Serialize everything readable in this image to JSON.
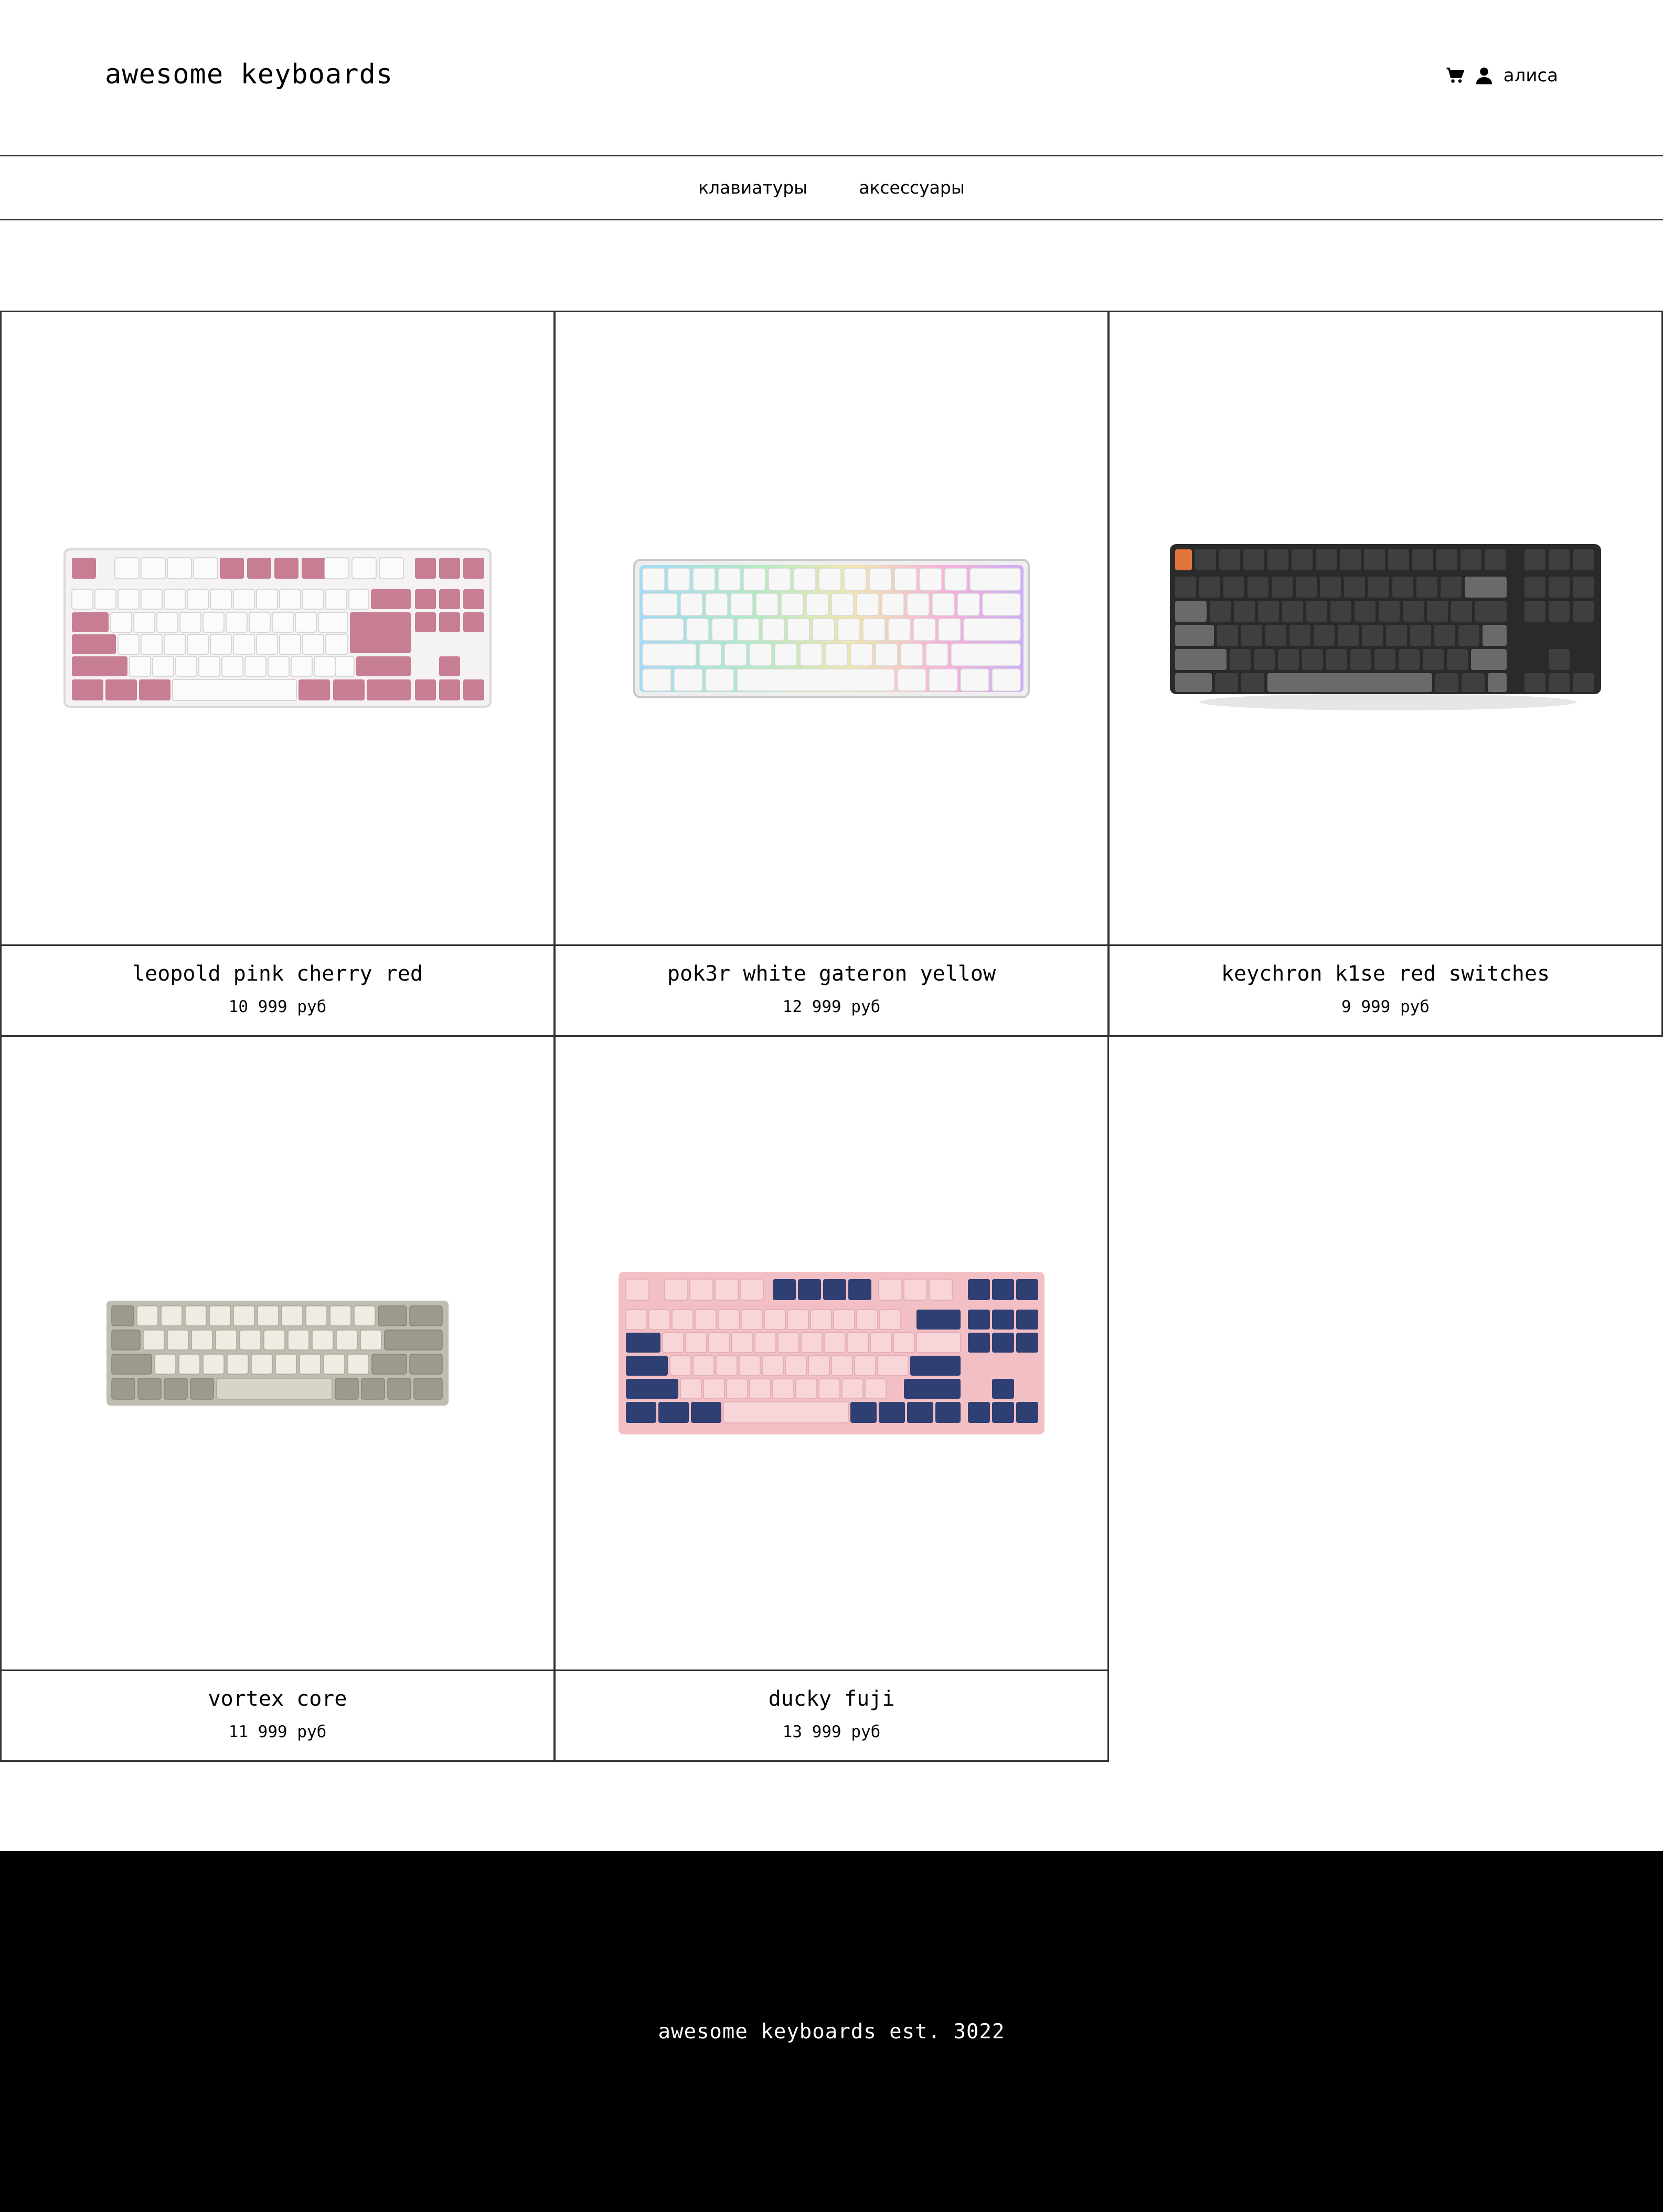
{
  "header": {
    "logo": "awesome keyboards",
    "cart_icon": "cart-icon",
    "user_icon": "user-icon",
    "user_name": "алиса"
  },
  "nav": {
    "items": [
      {
        "label": "клавиатуры"
      },
      {
        "label": "аксессуары"
      }
    ]
  },
  "products": [
    {
      "name": "leopold pink cherry red",
      "price": "10 999 руб",
      "image_icon": "keyboard-pink-white-image"
    },
    {
      "name": "pok3r white gateron yellow",
      "price": "12 999 руб",
      "image_icon": "keyboard-white-rgb-image"
    },
    {
      "name": "keychron k1se red switches",
      "price": "9 999 руб",
      "image_icon": "keyboard-black-image"
    },
    {
      "name": "vortex core",
      "price": "11 999 руб",
      "image_icon": "keyboard-beige-40-image"
    },
    {
      "name": "ducky fuji",
      "price": "13 999 руб",
      "image_icon": "keyboard-pink-navy-image"
    }
  ],
  "footer": {
    "text": "awesome keyboards est. 3022"
  }
}
